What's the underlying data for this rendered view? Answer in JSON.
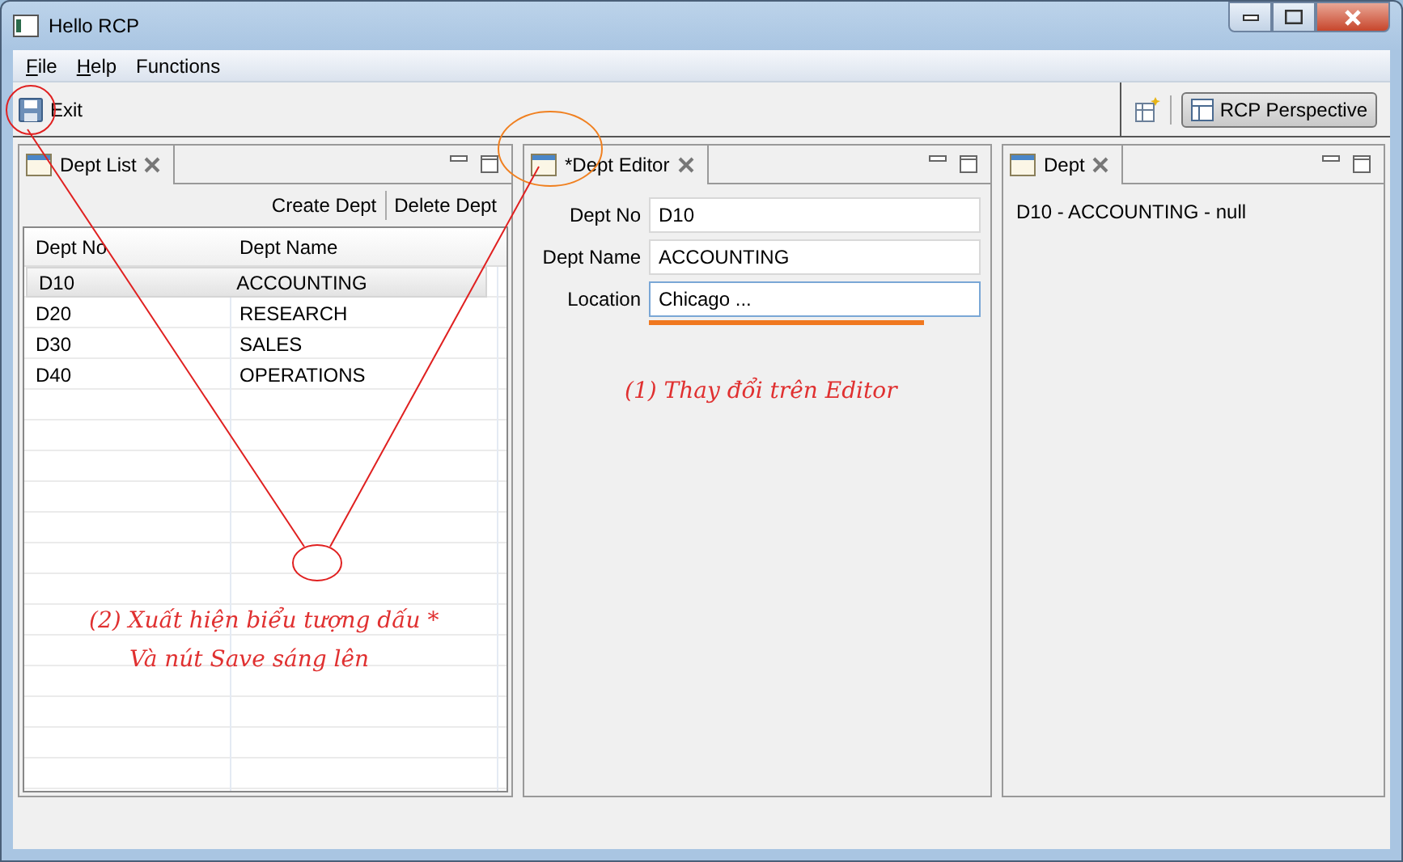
{
  "window": {
    "title": "Hello RCP"
  },
  "menu": [
    {
      "label": "File",
      "underline_first": true
    },
    {
      "label": "Help",
      "underline_first": true
    },
    {
      "label": "Functions",
      "underline_first": false
    }
  ],
  "toolbar": {
    "save_enabled": true,
    "exit_label": "Exit",
    "perspective": {
      "label": "RCP Perspective",
      "selected": true
    }
  },
  "dept_list": {
    "tab": "Dept List",
    "actions": [
      "Create Dept",
      "Delete Dept"
    ],
    "table": {
      "columns": [
        "Dept No",
        "Dept Name"
      ],
      "rows": [
        {
          "cells": [
            "D10",
            "ACCOUNTING"
          ],
          "selected": true
        },
        {
          "cells": [
            "D20",
            "RESEARCH"
          ],
          "selected": false
        },
        {
          "cells": [
            "D30",
            "SALES"
          ],
          "selected": false
        },
        {
          "cells": [
            "D40",
            "OPERATIONS"
          ],
          "selected": false
        }
      ]
    }
  },
  "editor": {
    "tab": "*Dept Editor",
    "fields": [
      {
        "label": "Dept No",
        "value": "D10",
        "focused": false
      },
      {
        "label": "Dept Name",
        "value": "ACCOUNTING",
        "focused": false
      },
      {
        "label": "Location",
        "value": "Chicago ...",
        "focused": true
      }
    ]
  },
  "dept_view": {
    "tab": "Dept",
    "text": "D10 - ACCOUNTING - null"
  },
  "annotations": [
    "(1) Thay đổi trên Editor",
    "(2) Xuất hiện biểu tượng dấu *",
    "Và nút Save sáng lên"
  ]
}
